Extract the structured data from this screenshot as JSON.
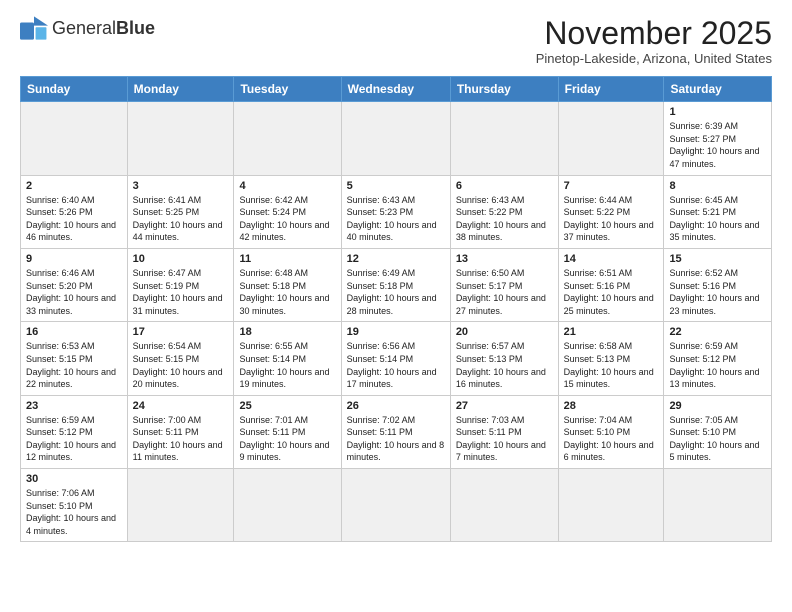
{
  "logo": {
    "text_general": "General",
    "text_blue": "Blue"
  },
  "header": {
    "month": "November 2025",
    "location": "Pinetop-Lakeside, Arizona, United States"
  },
  "weekdays": [
    "Sunday",
    "Monday",
    "Tuesday",
    "Wednesday",
    "Thursday",
    "Friday",
    "Saturday"
  ],
  "weeks": [
    [
      {
        "day": "",
        "info": ""
      },
      {
        "day": "",
        "info": ""
      },
      {
        "day": "",
        "info": ""
      },
      {
        "day": "",
        "info": ""
      },
      {
        "day": "",
        "info": ""
      },
      {
        "day": "",
        "info": ""
      },
      {
        "day": "1",
        "info": "Sunrise: 6:39 AM\nSunset: 5:27 PM\nDaylight: 10 hours and 47 minutes."
      }
    ],
    [
      {
        "day": "2",
        "info": "Sunrise: 6:40 AM\nSunset: 5:26 PM\nDaylight: 10 hours and 46 minutes."
      },
      {
        "day": "3",
        "info": "Sunrise: 6:41 AM\nSunset: 5:25 PM\nDaylight: 10 hours and 44 minutes."
      },
      {
        "day": "4",
        "info": "Sunrise: 6:42 AM\nSunset: 5:24 PM\nDaylight: 10 hours and 42 minutes."
      },
      {
        "day": "5",
        "info": "Sunrise: 6:43 AM\nSunset: 5:23 PM\nDaylight: 10 hours and 40 minutes."
      },
      {
        "day": "6",
        "info": "Sunrise: 6:43 AM\nSunset: 5:22 PM\nDaylight: 10 hours and 38 minutes."
      },
      {
        "day": "7",
        "info": "Sunrise: 6:44 AM\nSunset: 5:22 PM\nDaylight: 10 hours and 37 minutes."
      },
      {
        "day": "8",
        "info": "Sunrise: 6:45 AM\nSunset: 5:21 PM\nDaylight: 10 hours and 35 minutes."
      }
    ],
    [
      {
        "day": "9",
        "info": "Sunrise: 6:46 AM\nSunset: 5:20 PM\nDaylight: 10 hours and 33 minutes."
      },
      {
        "day": "10",
        "info": "Sunrise: 6:47 AM\nSunset: 5:19 PM\nDaylight: 10 hours and 31 minutes."
      },
      {
        "day": "11",
        "info": "Sunrise: 6:48 AM\nSunset: 5:18 PM\nDaylight: 10 hours and 30 minutes."
      },
      {
        "day": "12",
        "info": "Sunrise: 6:49 AM\nSunset: 5:18 PM\nDaylight: 10 hours and 28 minutes."
      },
      {
        "day": "13",
        "info": "Sunrise: 6:50 AM\nSunset: 5:17 PM\nDaylight: 10 hours and 27 minutes."
      },
      {
        "day": "14",
        "info": "Sunrise: 6:51 AM\nSunset: 5:16 PM\nDaylight: 10 hours and 25 minutes."
      },
      {
        "day": "15",
        "info": "Sunrise: 6:52 AM\nSunset: 5:16 PM\nDaylight: 10 hours and 23 minutes."
      }
    ],
    [
      {
        "day": "16",
        "info": "Sunrise: 6:53 AM\nSunset: 5:15 PM\nDaylight: 10 hours and 22 minutes."
      },
      {
        "day": "17",
        "info": "Sunrise: 6:54 AM\nSunset: 5:15 PM\nDaylight: 10 hours and 20 minutes."
      },
      {
        "day": "18",
        "info": "Sunrise: 6:55 AM\nSunset: 5:14 PM\nDaylight: 10 hours and 19 minutes."
      },
      {
        "day": "19",
        "info": "Sunrise: 6:56 AM\nSunset: 5:14 PM\nDaylight: 10 hours and 17 minutes."
      },
      {
        "day": "20",
        "info": "Sunrise: 6:57 AM\nSunset: 5:13 PM\nDaylight: 10 hours and 16 minutes."
      },
      {
        "day": "21",
        "info": "Sunrise: 6:58 AM\nSunset: 5:13 PM\nDaylight: 10 hours and 15 minutes."
      },
      {
        "day": "22",
        "info": "Sunrise: 6:59 AM\nSunset: 5:12 PM\nDaylight: 10 hours and 13 minutes."
      }
    ],
    [
      {
        "day": "23",
        "info": "Sunrise: 6:59 AM\nSunset: 5:12 PM\nDaylight: 10 hours and 12 minutes."
      },
      {
        "day": "24",
        "info": "Sunrise: 7:00 AM\nSunset: 5:11 PM\nDaylight: 10 hours and 11 minutes."
      },
      {
        "day": "25",
        "info": "Sunrise: 7:01 AM\nSunset: 5:11 PM\nDaylight: 10 hours and 9 minutes."
      },
      {
        "day": "26",
        "info": "Sunrise: 7:02 AM\nSunset: 5:11 PM\nDaylight: 10 hours and 8 minutes."
      },
      {
        "day": "27",
        "info": "Sunrise: 7:03 AM\nSunset: 5:11 PM\nDaylight: 10 hours and 7 minutes."
      },
      {
        "day": "28",
        "info": "Sunrise: 7:04 AM\nSunset: 5:10 PM\nDaylight: 10 hours and 6 minutes."
      },
      {
        "day": "29",
        "info": "Sunrise: 7:05 AM\nSunset: 5:10 PM\nDaylight: 10 hours and 5 minutes."
      }
    ],
    [
      {
        "day": "30",
        "info": "Sunrise: 7:06 AM\nSunset: 5:10 PM\nDaylight: 10 hours and 4 minutes."
      },
      {
        "day": "",
        "info": ""
      },
      {
        "day": "",
        "info": ""
      },
      {
        "day": "",
        "info": ""
      },
      {
        "day": "",
        "info": ""
      },
      {
        "day": "",
        "info": ""
      },
      {
        "day": "",
        "info": ""
      }
    ]
  ]
}
